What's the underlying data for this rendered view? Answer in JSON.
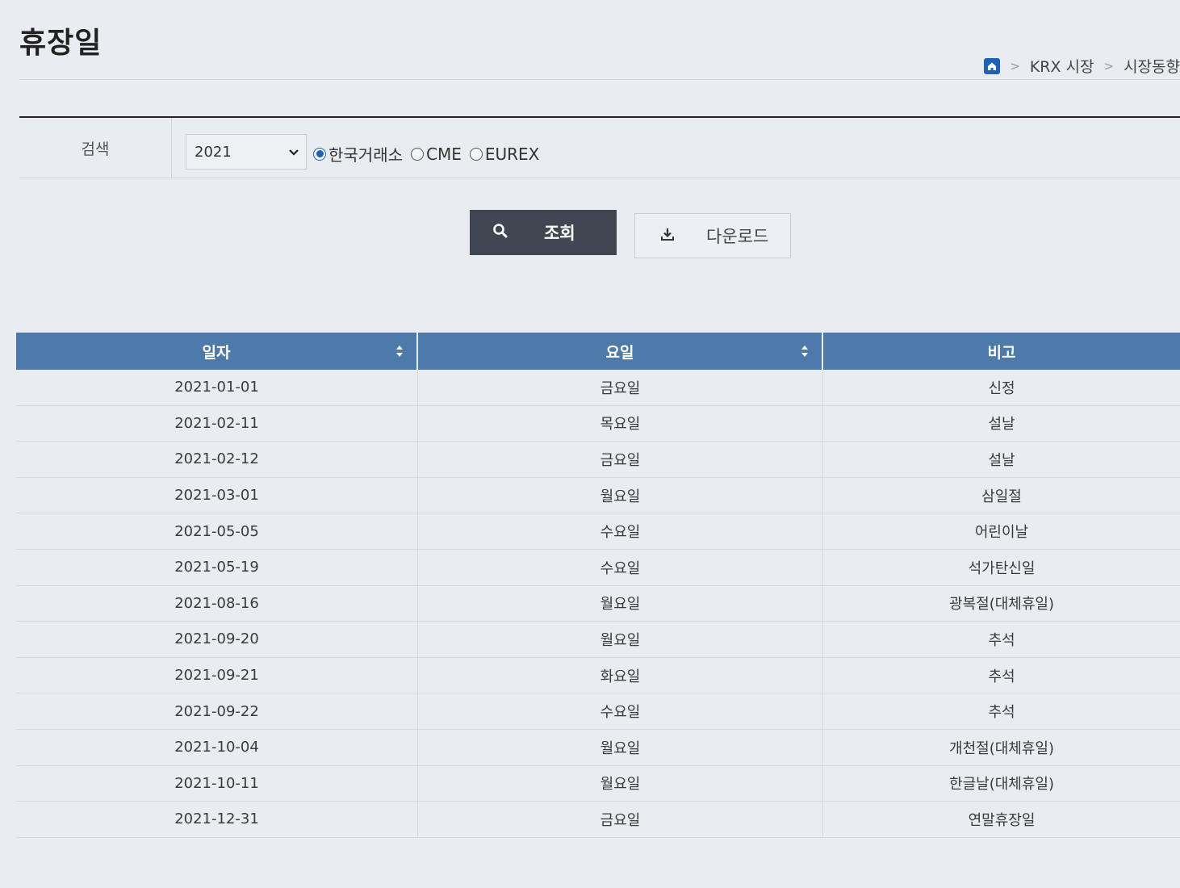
{
  "page": {
    "title": "휴장일"
  },
  "breadcrumb": {
    "items": [
      "KRX 시장",
      "시장동향"
    ],
    "separator": ">"
  },
  "search": {
    "label": "검색",
    "year": "2021",
    "markets": [
      {
        "label": "한국거래소",
        "checked": true
      },
      {
        "label": "CME",
        "checked": false
      },
      {
        "label": "EUREX",
        "checked": false
      }
    ],
    "search_button": "조회",
    "download_button": "다운로드"
  },
  "table": {
    "columns": [
      "일자",
      "요일",
      "비고"
    ],
    "rows": [
      [
        "2021-01-01",
        "금요일",
        "신정"
      ],
      [
        "2021-02-11",
        "목요일",
        "설날"
      ],
      [
        "2021-02-12",
        "금요일",
        "설날"
      ],
      [
        "2021-03-01",
        "월요일",
        "삼일절"
      ],
      [
        "2021-05-05",
        "수요일",
        "어린이날"
      ],
      [
        "2021-05-19",
        "수요일",
        "석가탄신일"
      ],
      [
        "2021-08-16",
        "월요일",
        "광복절(대체휴일)"
      ],
      [
        "2021-09-20",
        "월요일",
        "추석"
      ],
      [
        "2021-09-21",
        "화요일",
        "추석"
      ],
      [
        "2021-09-22",
        "수요일",
        "추석"
      ],
      [
        "2021-10-04",
        "월요일",
        "개천절(대체휴일)"
      ],
      [
        "2021-10-11",
        "월요일",
        "한글날(대체휴일)"
      ],
      [
        "2021-12-31",
        "금요일",
        "연말휴장일"
      ]
    ]
  },
  "colors": {
    "accent": "#1f62b3",
    "header_bg": "#4d7aa8",
    "search_button_bg": "#3f4852"
  }
}
